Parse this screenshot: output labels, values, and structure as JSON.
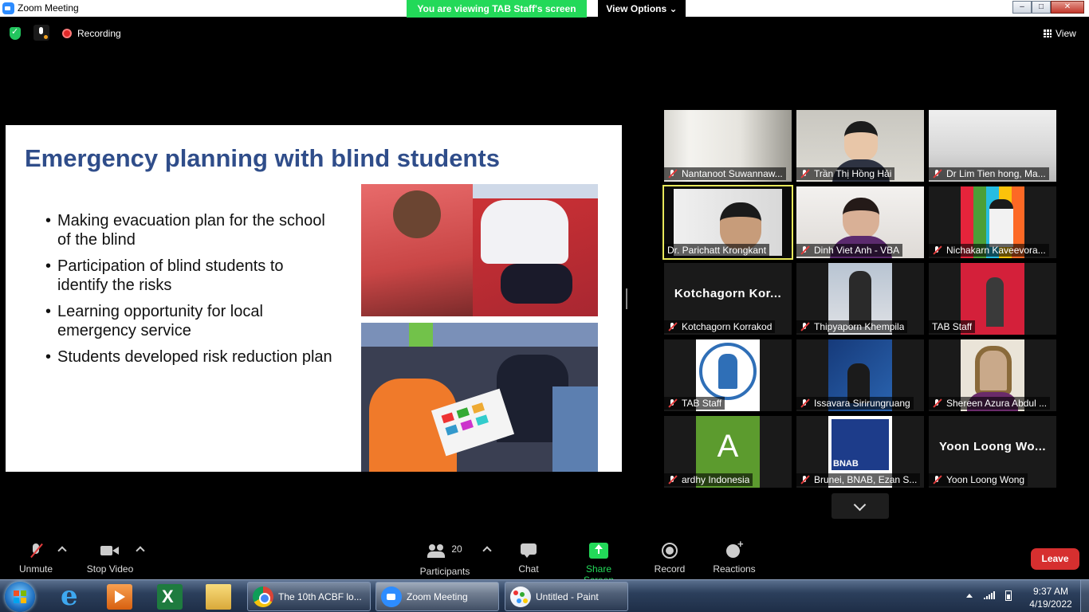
{
  "window": {
    "title": "Zoom Meeting",
    "banner": "You are viewing TAB Staff's screen",
    "view_options": "View Options",
    "min": "–",
    "max": "□",
    "close": "✕"
  },
  "topbar": {
    "recording": "Recording",
    "view": "View"
  },
  "slide": {
    "title": "Emergency planning with blind students",
    "bullets": [
      "Making evacuation plan for the school of the blind",
      "Participation of blind students to identify the risks",
      "Learning opportunity for local emergency service",
      "Students developed risk reduction plan"
    ]
  },
  "gallery": [
    {
      "name": "Nantanoot Suwannaw...",
      "muted": true
    },
    {
      "name": "Trần Thị Hồng Hải",
      "muted": true
    },
    {
      "name": "Dr Lim Tien hong, Ma...",
      "muted": true
    },
    {
      "name": "Dr. Parichatt Krongkant",
      "muted": false,
      "active": true
    },
    {
      "name": "Dinh Viet Anh - VBA",
      "muted": true
    },
    {
      "name": "Nichakarn Kaveevora...",
      "muted": true
    },
    {
      "name": "Kotchagorn Korrakod",
      "muted": true,
      "big_name": "Kotchagorn Kor..."
    },
    {
      "name": "Thipyaporn Khempila",
      "muted": true
    },
    {
      "name": "TAB Staff",
      "muted": false
    },
    {
      "name": "TAB Staff",
      "muted": true
    },
    {
      "name": "Issavara Sirirungruang",
      "muted": true
    },
    {
      "name": "Shereen Azura Abdul ...",
      "muted": true
    },
    {
      "name": "ardhy Indonesia",
      "muted": true,
      "avatar_letter": "A"
    },
    {
      "name": "Brunei, BNAB, Ezan S...",
      "muted": true,
      "logo_text": "BNAB"
    },
    {
      "name": "Yoon Loong Wong",
      "muted": true,
      "big_name": "Yoon Loong Wo..."
    }
  ],
  "toolbar": {
    "unmute": "Unmute",
    "stop_video": "Stop Video",
    "participants_count": "20",
    "participants": "Participants",
    "chat": "Chat",
    "share_screen": "Share Screen",
    "record": "Record",
    "reactions": "Reactions",
    "leave": "Leave"
  },
  "taskbar": {
    "tasks": [
      "The 10th ACBF lo...",
      "Zoom Meeting",
      "Untitled - Paint"
    ],
    "time": "9:37 AM",
    "date": "4/19/2022"
  },
  "colors": {
    "banner_green": "#23d959",
    "slide_title_blue": "#2f4d8a",
    "leave_red": "#d62f2f",
    "active_speaker_yellow": "#e8e85a"
  }
}
